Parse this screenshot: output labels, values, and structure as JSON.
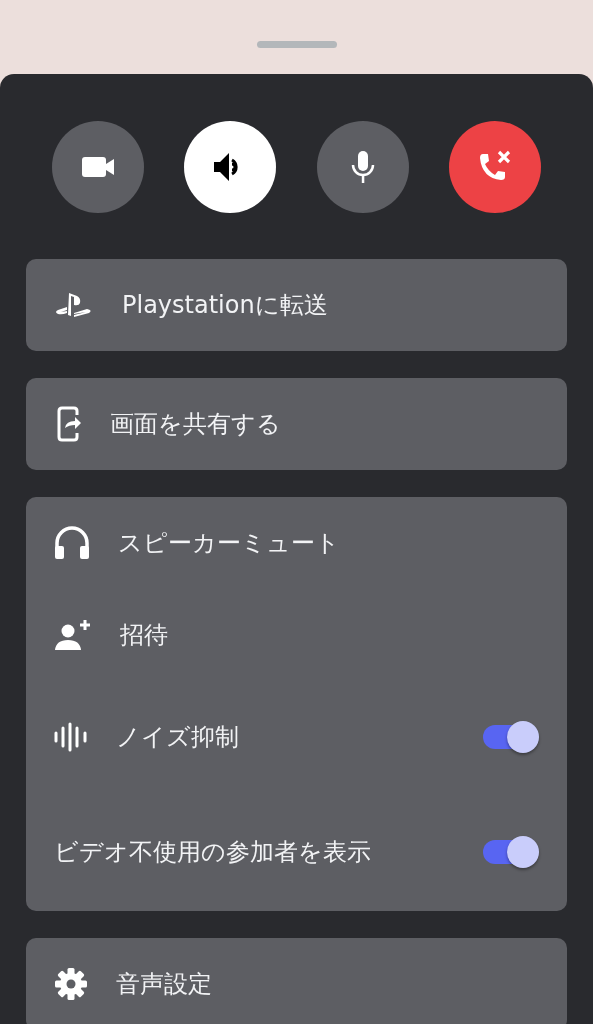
{
  "call_buttons": [
    {
      "kind": "video",
      "on": false
    },
    {
      "kind": "speaker",
      "on": true
    },
    {
      "kind": "mic",
      "on": false
    },
    {
      "kind": "hangup",
      "on": false
    }
  ],
  "sections": [
    {
      "items": [
        {
          "kind": "action",
          "label": "Playstationに転送"
        }
      ]
    },
    {
      "items": [
        {
          "kind": "action",
          "label": "画面を共有する"
        }
      ]
    },
    {
      "items": [
        {
          "kind": "action",
          "label": "スピーカーミュート"
        },
        {
          "kind": "action",
          "label": "招待"
        },
        {
          "kind": "toggle",
          "label": "ノイズ抑制",
          "on": true
        },
        {
          "kind": "toggle",
          "label": "ビデオ不使用の参加者を表示",
          "on": true
        }
      ]
    },
    {
      "items": [
        {
          "kind": "action",
          "label": "音声設定"
        }
      ]
    }
  ]
}
